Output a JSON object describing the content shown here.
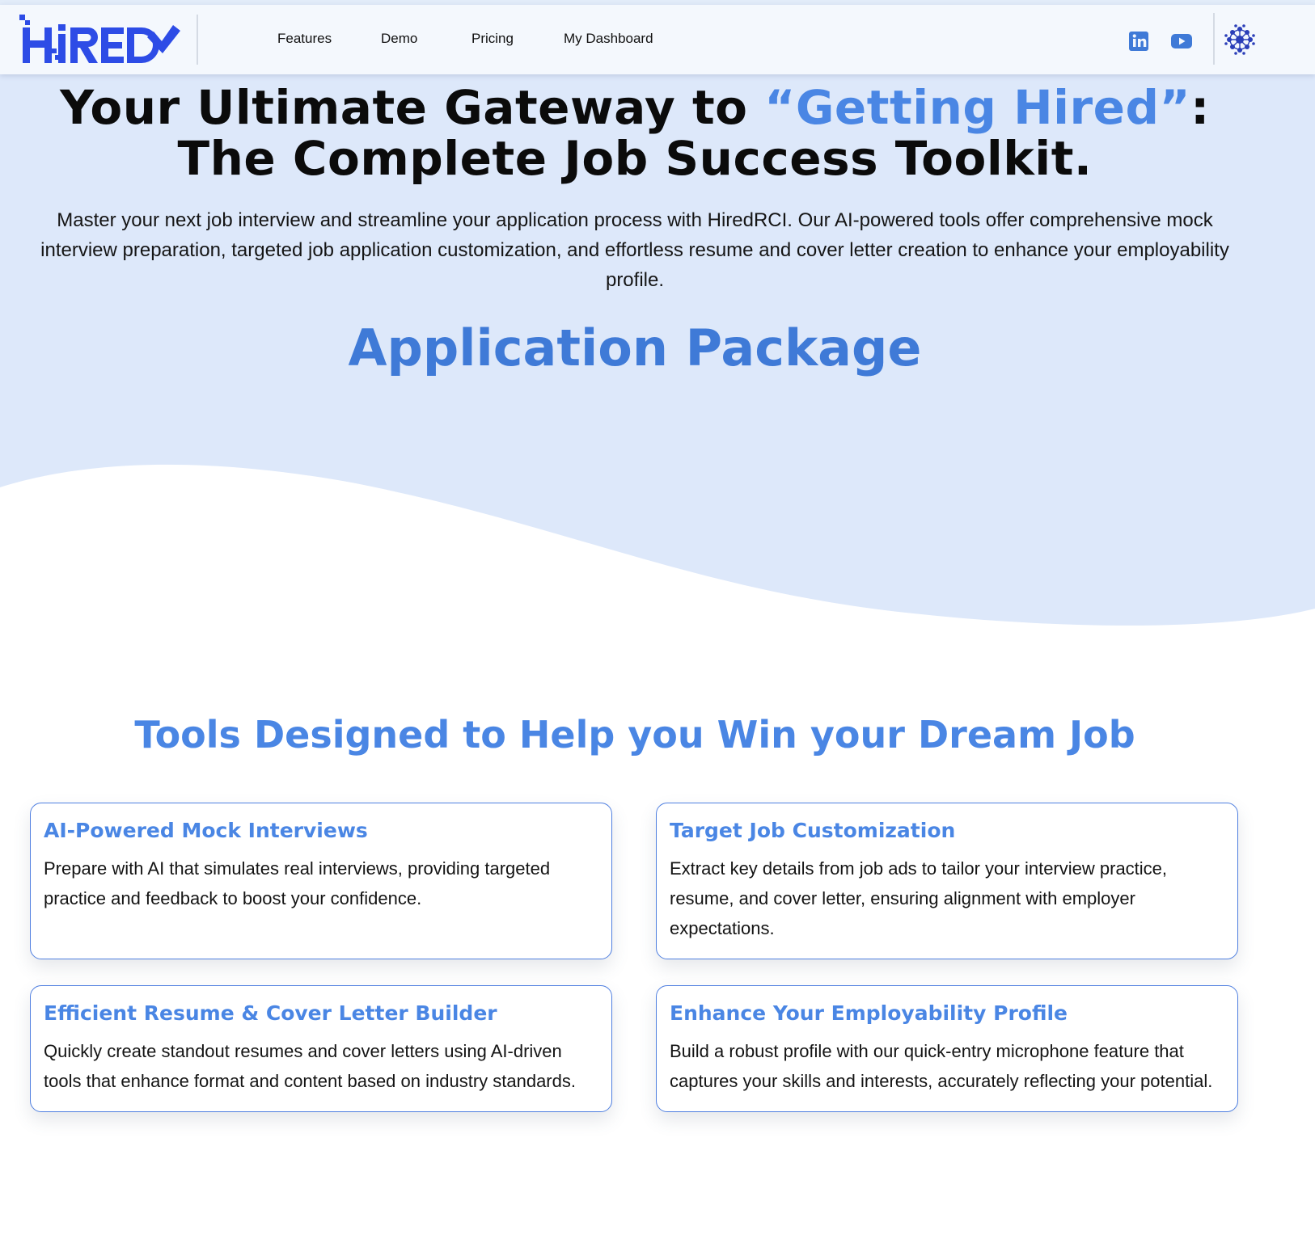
{
  "brand": {
    "logo_text": "HiRED",
    "primary_color": "#2d4ce6",
    "accent_color": "#4a86e4",
    "hero_bg_color": "#dde8fa"
  },
  "nav": {
    "links": [
      "Features",
      "Demo",
      "Pricing",
      "My Dashboard"
    ],
    "social": [
      "linkedin-icon",
      "youtube-icon"
    ],
    "avatar_icon": "profile-emblem-icon"
  },
  "hero": {
    "title_part1": "Your Ultimate Gateway to ",
    "title_highlight": "“Getting Hired”",
    "title_part2": ":",
    "title_line2": "The Complete Job Success Toolkit.",
    "subtitle": "Master your next job interview and streamline your application process with HiredRCI. Our AI-powered tools offer comprehensive mock interview preparation, targeted job application customization, and effortless resume and cover letter creation to enhance your employability profile.",
    "package_title": "Application Package"
  },
  "tools": {
    "title": "Tools Designed to Help you Win your Dream Job",
    "cards": [
      {
        "title": "AI-Powered Mock Interviews",
        "body": "Prepare with AI that simulates real interviews, providing targeted practice and feedback to boost your confidence."
      },
      {
        "title": "Target Job Customization",
        "body": "Extract key details from job ads to tailor your interview practice, resume, and cover letter, ensuring alignment with employer expectations."
      },
      {
        "title": "Efficient Resume & Cover Letter Builder",
        "body": "Quickly create standout resumes and cover letters using AI-driven tools that enhance format and content based on industry standards."
      },
      {
        "title": "Enhance Your Employability Profile",
        "body": "Build a robust profile with our quick-entry microphone feature that captures your skills and interests, accurately reflecting your potential."
      }
    ]
  }
}
